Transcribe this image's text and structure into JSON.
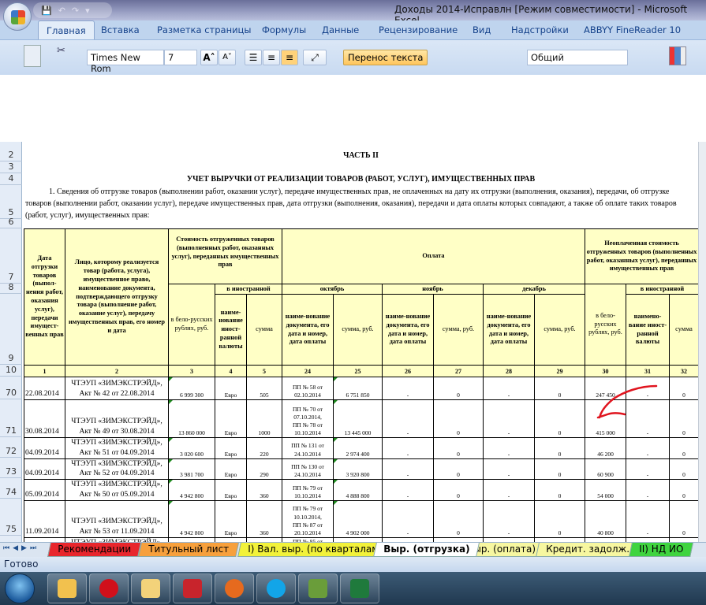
{
  "window": {
    "title": "Доходы 2014-Исправлн  [Режим совместимости] - Microsoft Excel"
  },
  "qat": {
    "save": "💾",
    "undo": "↶",
    "redo": "↷",
    "more": "▾"
  },
  "tabs": [
    "Главная",
    "Вставка",
    "Разметка страницы",
    "Формулы",
    "Данные",
    "Рецензирование",
    "Вид",
    "Надстройки",
    "ABBYY FineReader 10"
  ],
  "ribbon": {
    "font_name": "Times New Rom",
    "font_size": "7",
    "grow_font": "A˄",
    "shrink_font": "A˅",
    "wrap_text": "Перенос текста",
    "number_format": "Общий"
  },
  "row_headers": [
    "2",
    "3",
    "4",
    "5",
    "6",
    "7",
    "8",
    "9",
    "10",
    "70",
    "71",
    "72",
    "73",
    "74",
    "75"
  ],
  "sheet": {
    "part": "ЧАСТЬ II",
    "heading": "УЧЕТ ВЫРУЧКИ ОТ РЕАЛИЗАЦИИ ТОВАРОВ (РАБОТ, УСЛУГ), ИМУЩЕСТВЕННЫХ ПРАВ",
    "intro": "1. Сведения об отгрузке товаров (выполнении работ, оказании услуг), передаче имущественных прав, не оплаченных на дату их отгрузки (выполнения, оказания), передачи, об отгрузке товаров (выполнении работ, оказании услуг), передаче имущественных прав, дата отгрузки (выполнения, оказания), передачи и дата оплаты которых совпадают, а также об оплате таких товаров (работ, услуг), имущественных прав:"
  },
  "table": {
    "h_date": "Дата отгрузки товаров (выпол-нения работ, оказания услуг), передачи имущест-венных прав",
    "h_person": "Лицо, которому реализуется товар (работа, услуга), имущественное право, наименование документа, подтверждающего отгрузку товара (выполнение работ, оказание услуг), передачу имущественных прав, его номер и дата",
    "h_cost": "Стоимость отгруженных товаров (выполненных работ, оказанных услуг), переданных имущественных прав",
    "h_payment": "Оплата",
    "h_unpaid": "Неоплаченная стоимость отгруженных товаров (выполненных работ, оказанных услуг), переданных имущественных прав",
    "h_foreign": "в иностранной",
    "h_foreign2": "в иностранной",
    "h_october": "октябрь",
    "h_november": "ноябрь",
    "h_december": "декабрь",
    "h_byr": "в бело-русских рублях, руб.",
    "h_byr2": "в бело-русских рублях, руб.",
    "h_currency": "наиме-нование иност-ранной валюты",
    "h_currency2": "наимено-вание иност-ранной валюты",
    "h_sum": "сумма",
    "h_sum2": "сумма",
    "h_doc": "наиме-нование документа, его дата и номер, дата оплаты",
    "h_sum_rub": "сумма, руб.",
    "col_numbers": [
      "1",
      "2",
      "3",
      "4",
      "5",
      "24",
      "25",
      "26",
      "27",
      "28",
      "29",
      "30",
      "31",
      "32"
    ],
    "rows": [
      [
        "22.08.2014",
        "ЧТЭУП «ЗИМЭКСТРЭЙД»,\nАкт № 42 от 22.08.2014",
        "6 999 300",
        "Евро",
        "505",
        "ПП № 58 от\n02.10.2014",
        "6 751 850",
        "-",
        "0",
        "-",
        "0",
        "247 450",
        "-",
        "0"
      ],
      [
        "30.08.2014",
        "ЧТЭУП «ЗИМЭКСТРЭЙД»,\nАкт № 49 от 30.08.2014",
        "13 860 000",
        "Евро",
        "1000",
        "ПП № 70 от\n07.10.2014,\nПП № 78 от\n10.10.2014",
        "13 445 000",
        "-",
        "0",
        "-",
        "0",
        "415 000",
        "-",
        "0"
      ],
      [
        "04.09.2014",
        "ЧТЭУП «ЗИМЭКСТРЭЙД»,\nАкт № 51 от 04.09.2014",
        "3 020 600",
        "Евро",
        "220",
        "ПП № 131 от\n24.10.2014",
        "2 974 400",
        "-",
        "0",
        "-",
        "0",
        "46 200",
        "-",
        "0"
      ],
      [
        "04.09.2014",
        "ЧТЭУП «ЗИМЭКСТРЭЙД»,\nАкт № 52 от 04.09.2014",
        "3 981 700",
        "Евро",
        "290",
        "ПП № 130 от\n24.10.2014",
        "3 920 800",
        "-",
        "0",
        "-",
        "0",
        "60 900",
        "-",
        "0"
      ],
      [
        "05.09.2014",
        "ЧТЭУП «ЗИМЭКСТРЭЙД»,\nАкт № 50 от 05.09.2014",
        "4 942 800",
        "Евро",
        "360",
        "ПП № 79 от\n10.10.2014",
        "4 888 800",
        "-",
        "0",
        "-",
        "0",
        "54 000",
        "-",
        "0"
      ],
      [
        "11.09.2014",
        "ЧТЭУП «ЗИМЭКСТРЭЙД»,\nАкт № 53 от 11.09.2014",
        "4 942 800",
        "Евро",
        "360",
        "ПП № 79 от\n10.10.2014,\nПП № 87 от\n20.10.2014",
        "4 902 000",
        "-",
        "0",
        "-",
        "0",
        "40 800",
        "-",
        "0"
      ],
      [
        "",
        "ЧТЭУП «ЗИМЭКСТРЭЙД»,",
        "",
        "",
        "",
        "ПП № 85 от",
        "",
        "",
        "",
        "",
        "",
        "",
        "",
        ""
      ]
    ]
  },
  "sheet_tabs": [
    {
      "label": "Рекомендации",
      "color": "#e8262c"
    },
    {
      "label": "Титульный лист",
      "color": "#f7a03c"
    },
    {
      "label": "I) Вал. выр. (по кварталам)",
      "color": "#f2f23a"
    },
    {
      "label": "Выр. (отгрузка)",
      "color": "#ffffff"
    },
    {
      "label": "Выр. (оплата)",
      "color": "#f7f7a0"
    },
    {
      "label": "Кредит. задолж.",
      "color": "#f7f7a0"
    },
    {
      "label": "II) НД ИО",
      "color": "#3fd43f"
    }
  ],
  "status": {
    "ready": "Готово"
  },
  "taskbar": [
    "outlook",
    "opera",
    "file-explorer",
    "app-coat-of-arms",
    "firefox",
    "skype",
    "utility",
    "excel"
  ],
  "annotation_color": "#e0141e"
}
